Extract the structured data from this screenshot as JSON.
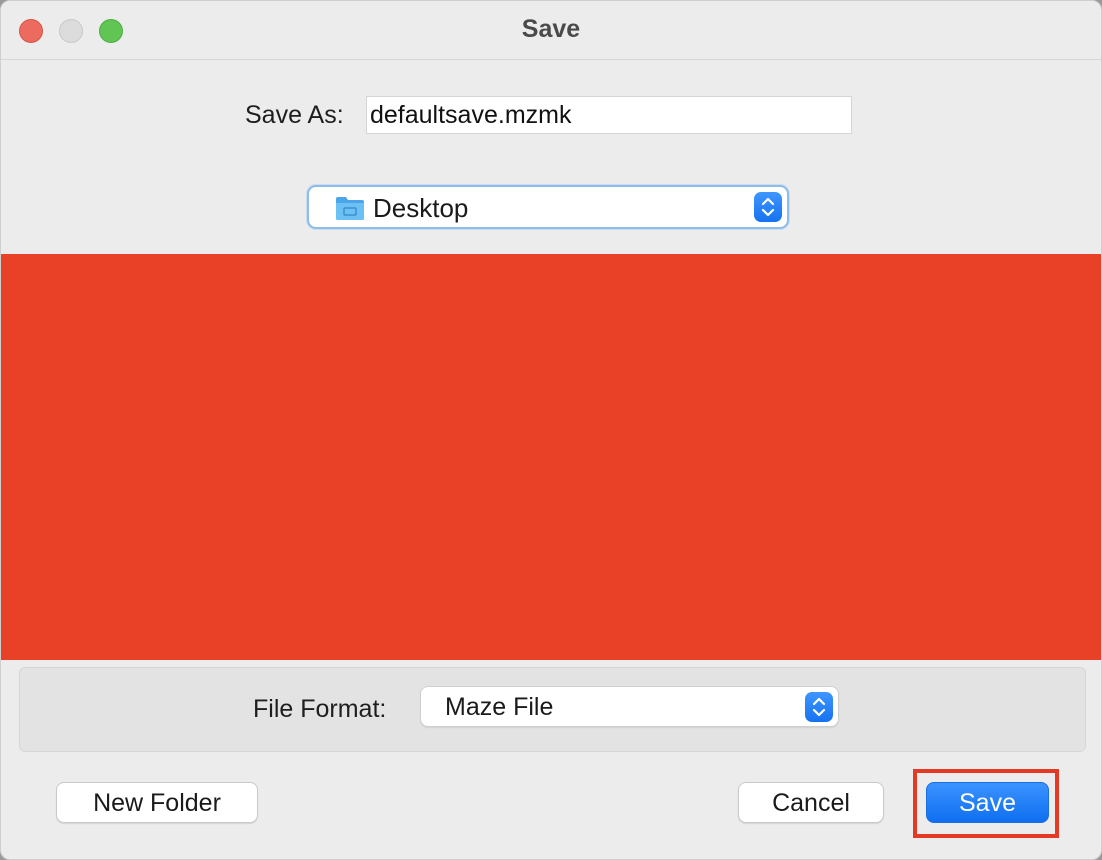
{
  "window": {
    "title": "Save",
    "icons": [
      "close-icon",
      "minimize-icon",
      "zoom-icon"
    ]
  },
  "save_as": {
    "label": "Save As:",
    "value": "defaultsave.mzmk"
  },
  "location": {
    "value": "Desktop",
    "icon": "folder-icon"
  },
  "file_format": {
    "label": "File Format:",
    "value": "Maze File"
  },
  "buttons": {
    "new_folder": "New Folder",
    "cancel": "Cancel",
    "save": "Save"
  },
  "colors": {
    "accent": "#1673f0",
    "browser_area": "#e84127",
    "highlight": "#e43a25"
  }
}
